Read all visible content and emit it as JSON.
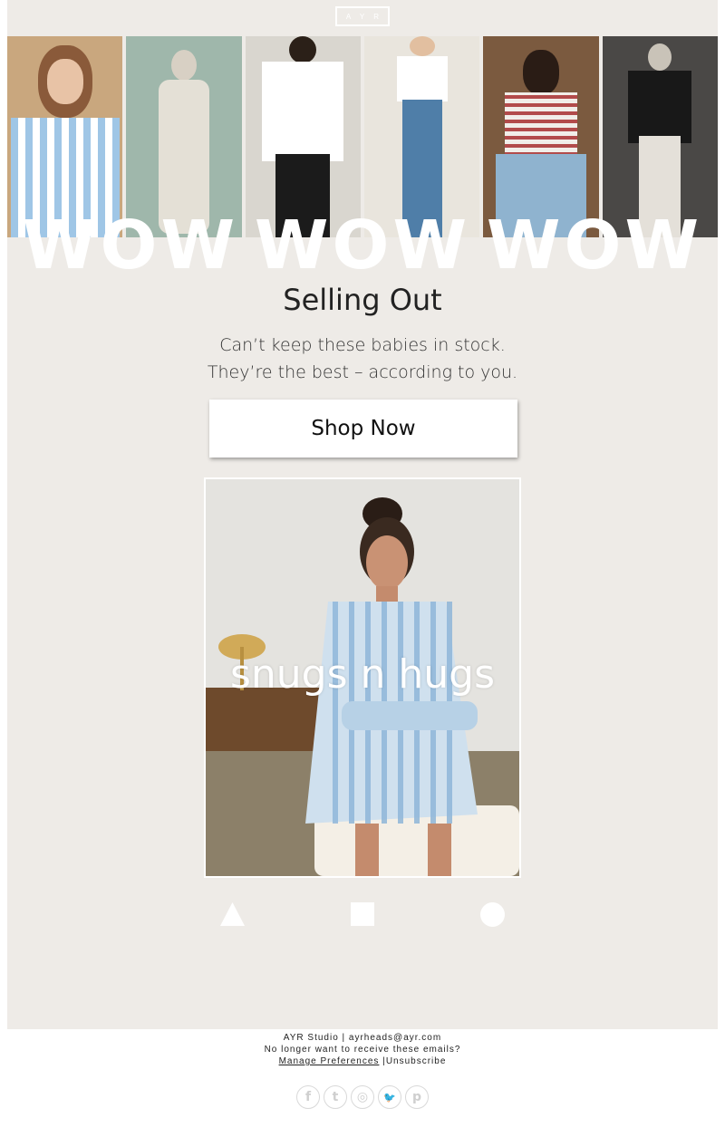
{
  "brand": {
    "logo_text": "A Y R"
  },
  "hero": {
    "overlay_text": [
      "WOW",
      "WOW",
      "WOW"
    ]
  },
  "content": {
    "headline": "Selling Out",
    "subline_1": "Can’t keep these babies in stock.",
    "subline_2": "They’re the best – according to you.",
    "cta_label": "Shop Now"
  },
  "feature": {
    "caption": "snugs n hugs"
  },
  "nav_shapes": [
    "triangle-icon",
    "square-icon",
    "circle-icon"
  ],
  "footer": {
    "company": "AYR Studio | ayrheads@ayr.com",
    "prompt": "No longer want to receive these emails?",
    "manage_label": "Manage Preferences",
    "separator": " |",
    "unsubscribe_label": "Unsubscribe"
  },
  "social": {
    "facebook": "f",
    "tumblr": "t",
    "instagram": "◎",
    "twitter": "🐦",
    "pinterest": "p"
  },
  "colors": {
    "background": "#eeebe7",
    "accent": "#ffffff",
    "text": "#222222"
  }
}
